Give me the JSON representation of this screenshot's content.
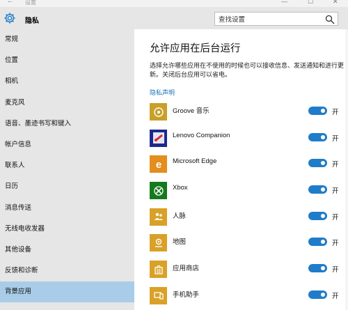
{
  "window": {
    "title": "设置",
    "back_glyph": "←",
    "controls": [
      "—",
      "☐",
      "✕"
    ]
  },
  "sidebar": {
    "brand": "隐私",
    "items": [
      {
        "label": "常规"
      },
      {
        "label": "位置"
      },
      {
        "label": "相机"
      },
      {
        "label": "麦克风"
      },
      {
        "label": "语音、墨迹书写和键入"
      },
      {
        "label": "帐户信息"
      },
      {
        "label": "联系人"
      },
      {
        "label": "日历"
      },
      {
        "label": "消息传送"
      },
      {
        "label": "无线电收发器"
      },
      {
        "label": "其他设备"
      },
      {
        "label": "反馈和诊断"
      },
      {
        "label": "背景应用"
      }
    ],
    "active_index": 12
  },
  "search": {
    "placeholder": "查找设置",
    "icon": "search-icon"
  },
  "main": {
    "title": "允许应用在后台运行",
    "description": "选择允许哪些应用在不使用的时候也可以接收信息、发送通知和进行更新。关闭后台应用可以省电。",
    "privacy_link": "隐私声明",
    "apps": [
      {
        "name": "Groove 音乐",
        "icon": "groove-music-icon",
        "tile_color": "#c8a02a",
        "state": "开",
        "on": true
      },
      {
        "name": "Lenovo Companion",
        "icon": "lenovo-companion-icon",
        "tile_color": "#1b2a8a",
        "state": "开",
        "on": true
      },
      {
        "name": "Microsoft Edge",
        "icon": "edge-icon",
        "tile_color": "#e38e1e",
        "state": "开",
        "on": true
      },
      {
        "name": "Xbox",
        "icon": "xbox-icon",
        "tile_color": "#157a1d",
        "state": "开",
        "on": true
      },
      {
        "name": "人脉",
        "icon": "people-icon",
        "tile_color": "#d9a128",
        "state": "开",
        "on": true
      },
      {
        "name": "地图",
        "icon": "maps-icon",
        "tile_color": "#d9a128",
        "state": "开",
        "on": true
      },
      {
        "name": "应用商店",
        "icon": "store-icon",
        "tile_color": "#d9a128",
        "state": "开",
        "on": true
      },
      {
        "name": "手机助手",
        "icon": "phone-companion-icon",
        "tile_color": "#d9a128",
        "state": "开",
        "on": true
      }
    ]
  },
  "colors": {
    "sidebar_bg": "#e6e6e6",
    "active_item_bg": "#a9cde8",
    "toggle_on": "#1f7cc9",
    "link": "#1a73b7"
  }
}
